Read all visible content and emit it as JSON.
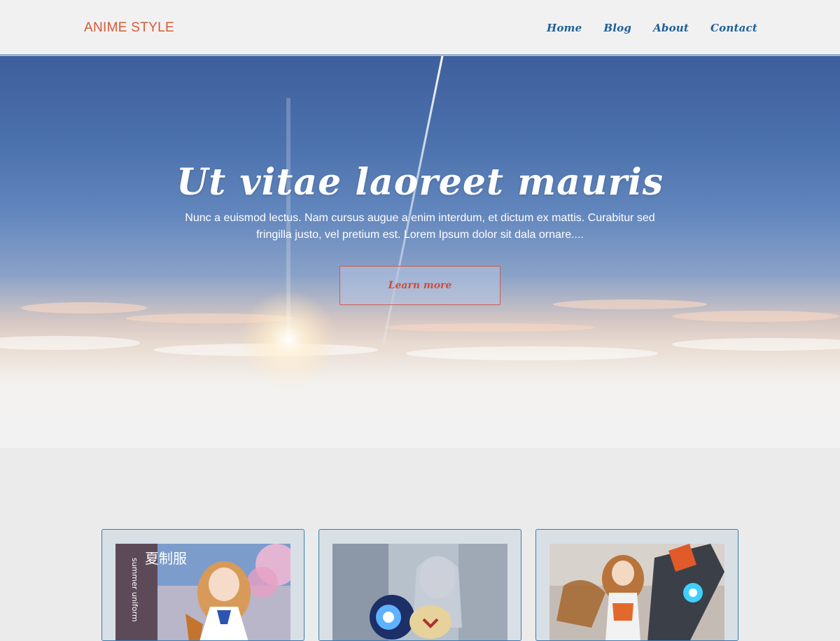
{
  "header": {
    "brand": "ANIME STYLE",
    "nav": [
      {
        "label": "Home"
      },
      {
        "label": "Blog"
      },
      {
        "label": "About"
      },
      {
        "label": "Contact"
      }
    ]
  },
  "hero": {
    "title": "Ut vitae laoreet mauris",
    "text": "Nunc a euismod lectus. Nam cursus augue a enim interdum, et dictum ex mattis. Curabitur sed fringilla justo, vel pretium est. Lorem Ipsum dolor sit dala ornare....",
    "button_label": "Learn more"
  },
  "cards": [
    {
      "image_alt": "anime girl in school uniform",
      "sign_text": "夏制服",
      "sign_subtext": "summer uniform"
    },
    {
      "image_alt": "anime girl with robot"
    },
    {
      "image_alt": "anime girl with mecha"
    }
  ],
  "colors": {
    "brand": "#d35a37",
    "nav": "#1d5f9a",
    "accent_button": "#cc4f3a",
    "card_border": "#3a7ab5"
  }
}
